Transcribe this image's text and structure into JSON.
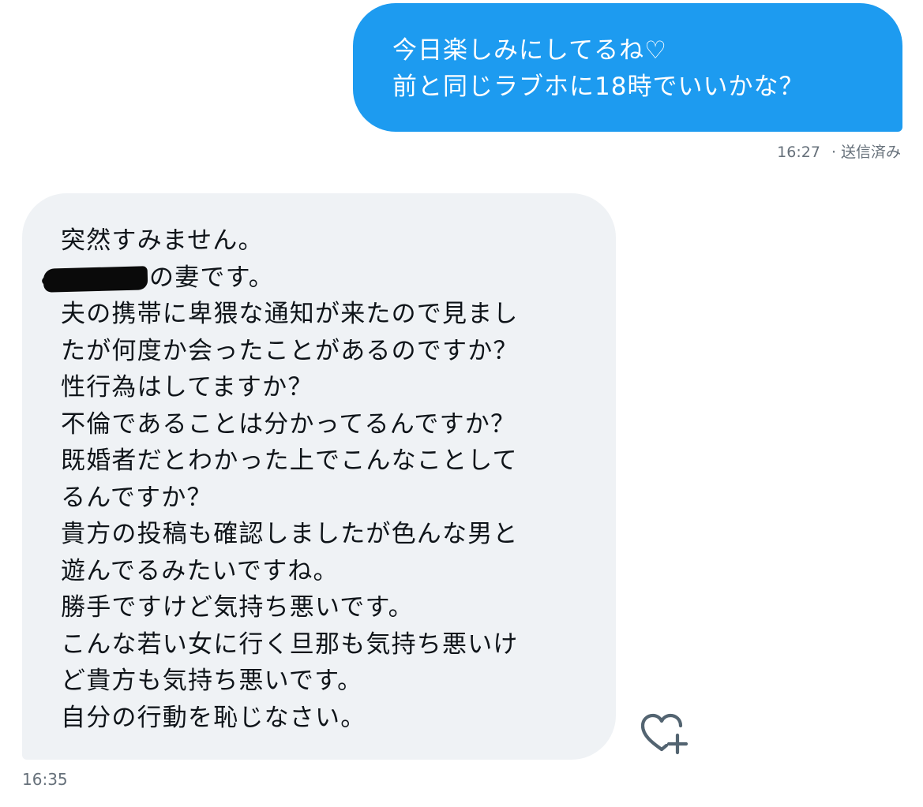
{
  "sent_message": {
    "lines": [
      "今日楽しみにしてるね♡",
      "前と同じラブホに18時でいいかな？"
    ],
    "time": "16:27",
    "status": "送信済み",
    "bubble_color": "#1d9bf0"
  },
  "received_message": {
    "lines": [
      "突然すみません。",
      "の妻です。",
      "夫の携帯に卑猥な通知が来たので見まし",
      "たが何度か会ったことがあるのですか？",
      "性行為はしてますか？",
      "不倫であることは分かってるんですか？",
      "既婚者だとわかった上でこんなことして",
      "るんですか？",
      "貴方の投稿も確認しましたが色んな男と",
      "遊んでるみたいですね。",
      "勝手ですけど気持ち悪いです。",
      "こんな若い女に行く旦那も気持ち悪いけ",
      "ど貴方も気持ち悪いです。",
      "自分の行動を恥じなさい。"
    ],
    "time": "16:35",
    "bubble_color": "#eff2f5"
  },
  "icons": {
    "like": "heart-plus-icon"
  }
}
